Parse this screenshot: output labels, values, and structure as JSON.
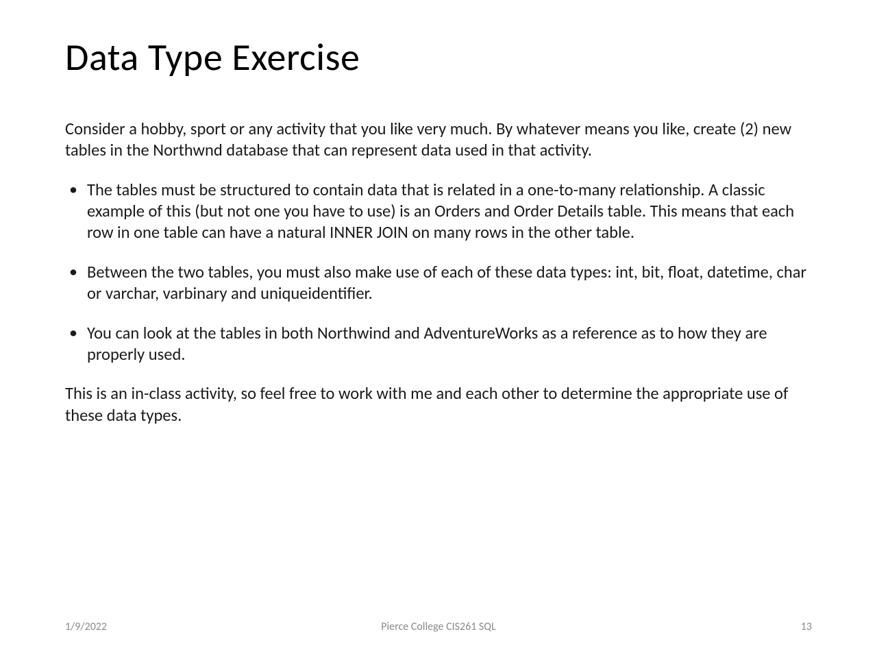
{
  "slide": {
    "title": "Data Type Exercise",
    "intro": "Consider a hobby, sport or any activity that you like very much. By whatever means you like, create (2) new tables in the Northwnd database that can represent data used in that activity.",
    "bullets": [
      "The tables must be structured to contain data that is related in a one-to-many relationship. A classic example of this (but not one you have to use) is an Orders and Order Details table. This means that each row in one table can have a natural INNER JOIN on many rows in the other table.",
      "Between the two tables, you must also make use of each of these data types: int, bit, float, datetime, char or varchar, varbinary and uniqueidentifier.",
      "You can look at the tables in both Northwind and AdventureWorks as a reference as to how they are properly used."
    ],
    "outro": "This is an in-class activity, so feel free to work with me and each other to determine the appropriate use of these data types."
  },
  "footer": {
    "date": "1/9/2022",
    "center": "Pierce College CIS261 SQL",
    "page": "13"
  }
}
